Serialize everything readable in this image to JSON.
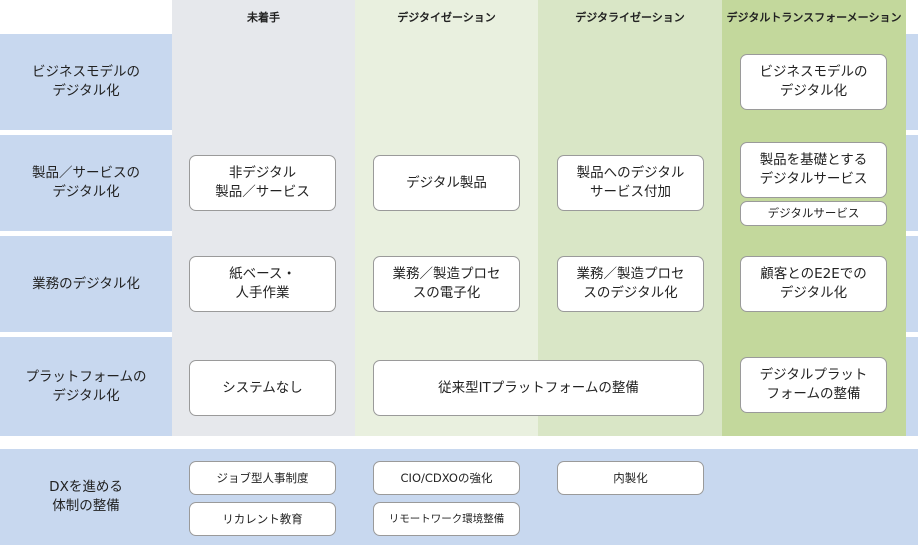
{
  "columns": {
    "not_started": "未着手",
    "digitization": "デジタイゼーション",
    "digitalization": "デジタライゼーション",
    "dx": "デジタルトランスフォーメーション"
  },
  "rows": {
    "business_model": "ビジネスモデルの\nデジタル化",
    "product_service": "製品／サービスの\nデジタル化",
    "operations": "業務のデジタル化",
    "platform": "プラットフォームの\nデジタル化",
    "dx_structure": "DXを進める\n体制の整備"
  },
  "cells": {
    "bm_dx": "ビジネスモデルの\nデジタル化",
    "ps_not_started": "非デジタル\n製品／サービス",
    "ps_digitization": "デジタル製品",
    "ps_digitalization": "製品へのデジタル\nサービス付加",
    "ps_dx_1": "製品を基礎とする\nデジタルサービス",
    "ps_dx_2": "デジタルサービス",
    "op_not_started": "紙ベース・\n人手作業",
    "op_digitization": "業務／製造プロセ\nスの電子化",
    "op_digitalization": "業務／製造プロセ\nスのデジタル化",
    "op_dx": "顧客とのE2Eでの\nデジタル化",
    "pf_not_started": "システムなし",
    "pf_legacy": "従来型ITプラットフォームの整備",
    "pf_dx": "デジタルプラット\nフォームの整備",
    "st_job": "ジョブ型人事制度",
    "st_recurrent": "リカレント教育",
    "st_cio": "CIO/CDXOの強化",
    "st_remote": "リモートワーク環境整備",
    "st_inhouse": "内製化"
  },
  "colors": {
    "row_band": "#c8d8ef",
    "col_not_started": "#e6e8ec",
    "col_digitization": "#e9f0df",
    "col_digitalization": "#d9e6c6",
    "col_dx": "#c3d89c",
    "box_border": "#9a9a9a"
  }
}
